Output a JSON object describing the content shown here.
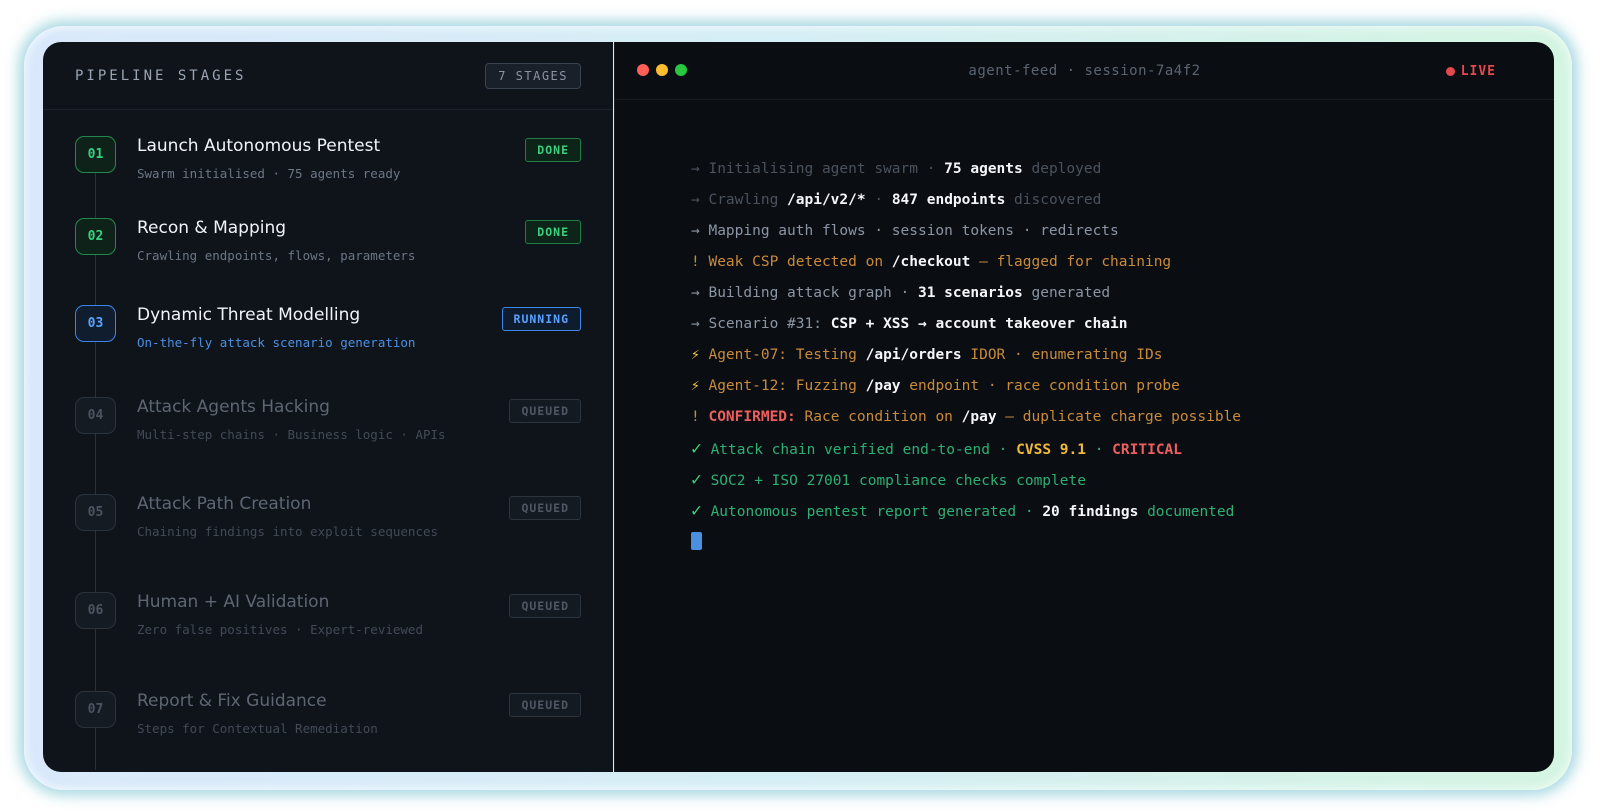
{
  "pipeline": {
    "title": "PIPELINE STAGES",
    "count_label": "7 STAGES",
    "stages": [
      {
        "num": "01",
        "name": "Launch Autonomous Pentest",
        "sub": "Swarm initialised · 75 agents ready",
        "status": "DONE"
      },
      {
        "num": "02",
        "name": "Recon & Mapping",
        "sub": "Crawling endpoints, flows, parameters",
        "status": "DONE"
      },
      {
        "num": "03",
        "name": "Dynamic Threat Modelling",
        "sub": "On-the-fly attack scenario generation",
        "status": "RUNNING"
      },
      {
        "num": "04",
        "name": "Attack Agents Hacking",
        "sub": "Multi-step chains · Business logic · APIs",
        "status": "QUEUED"
      },
      {
        "num": "05",
        "name": "Attack Path Creation",
        "sub": "Chaining findings into exploit sequences",
        "status": "QUEUED"
      },
      {
        "num": "06",
        "name": "Human + AI Validation",
        "sub": "Zero false positives · Expert-reviewed",
        "status": "QUEUED"
      },
      {
        "num": "07",
        "name": "Report & Fix Guidance",
        "sub": "Steps for Contextual Remediation",
        "status": "QUEUED"
      }
    ]
  },
  "terminal": {
    "title": "agent-feed · session-7a4f2",
    "live_label": "LIVE",
    "dot_colors": [
      "#ff5f57",
      "#febc2e",
      "#28c840"
    ],
    "lines": [
      [
        {
          "t": "→ Initialising agent swarm · ",
          "c": "c-dim"
        },
        {
          "t": "75 agents",
          "c": "c-white"
        },
        {
          "t": " deployed",
          "c": "c-dim"
        }
      ],
      [
        {
          "t": "→ Crawling ",
          "c": "c-dim"
        },
        {
          "t": "/api/v2/*",
          "c": "c-white"
        },
        {
          "t": " · ",
          "c": "c-dim"
        },
        {
          "t": "847 endpoints",
          "c": "c-white"
        },
        {
          "t": " discovered",
          "c": "c-dim"
        }
      ],
      [
        {
          "t": "→ Mapping auth flows · session tokens · redirects",
          "c": "c-mid"
        }
      ],
      [
        {
          "t": "! Weak CSP detected on ",
          "c": "c-orange"
        },
        {
          "t": "/checkout",
          "c": "c-white"
        },
        {
          "t": " — flagged for chaining",
          "c": "c-orange"
        }
      ],
      [
        {
          "t": "→ Building attack graph · ",
          "c": "c-mid"
        },
        {
          "t": "31 scenarios",
          "c": "c-white"
        },
        {
          "t": " generated",
          "c": "c-mid"
        }
      ],
      [
        {
          "t": "→ Scenario #31: ",
          "c": "c-mid"
        },
        {
          "t": "CSP + XSS → account takeover chain",
          "c": "c-white"
        }
      ],
      [
        {
          "t": "⚡",
          "c": "c-bolt"
        },
        {
          "t": " Agent-07: Testing ",
          "c": "c-orange"
        },
        {
          "t": "/api/orders",
          "c": "c-white"
        },
        {
          "t": " IDOR · enumerating IDs",
          "c": "c-orange"
        }
      ],
      [
        {
          "t": "⚡",
          "c": "c-bolt"
        },
        {
          "t": " Agent-12: Fuzzing ",
          "c": "c-orange"
        },
        {
          "t": "/pay",
          "c": "c-white"
        },
        {
          "t": " endpoint · race condition probe",
          "c": "c-orange"
        }
      ],
      [
        {
          "t": "!  ",
          "c": "c-orange"
        },
        {
          "t": "CONFIRMED:",
          "c": "c-red"
        },
        {
          "t": " Race condition on ",
          "c": "c-orange"
        },
        {
          "t": "/pay",
          "c": "c-white"
        },
        {
          "t": " — duplicate charge possible",
          "c": "c-orange"
        }
      ],
      [
        {
          "t": "✓",
          "c": "c-greenb"
        },
        {
          "t": " Attack chain verified end-to-end · ",
          "c": "c-green"
        },
        {
          "t": "CVSS 9.1",
          "c": "c-yellow"
        },
        {
          "t": " · ",
          "c": "c-green"
        },
        {
          "t": "CRITICAL",
          "c": "c-red"
        }
      ],
      [
        {
          "t": "✓",
          "c": "c-greenb"
        },
        {
          "t": " SOC2 + ISO 27001 compliance checks complete",
          "c": "c-green"
        }
      ],
      [
        {
          "t": "✓",
          "c": "c-greenb"
        },
        {
          "t": " Autonomous pentest report generated · ",
          "c": "c-green"
        },
        {
          "t": "20 findings",
          "c": "c-white"
        },
        {
          "t": " documented",
          "c": "c-green"
        }
      ]
    ]
  }
}
